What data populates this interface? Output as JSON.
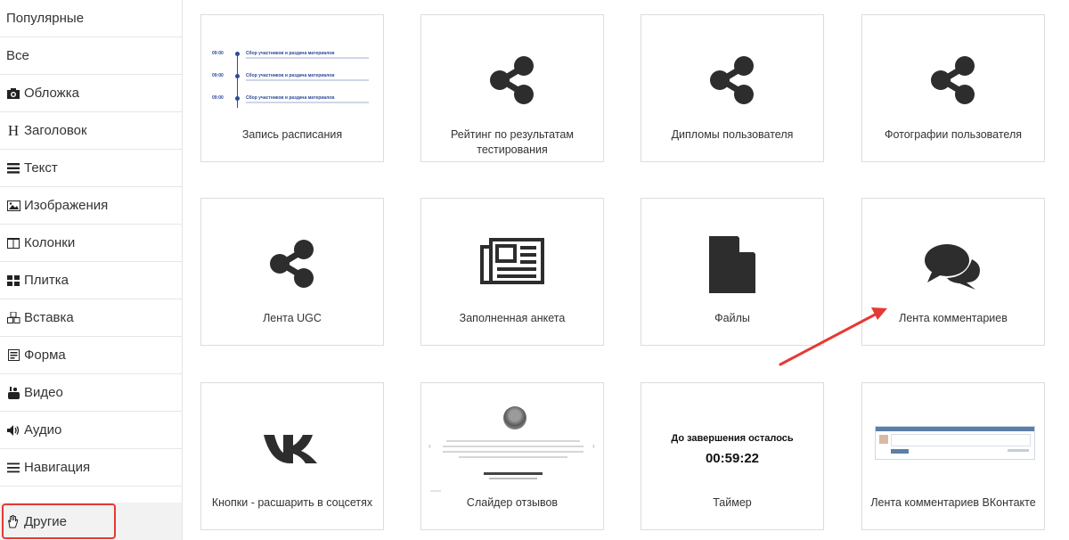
{
  "sidebar": {
    "items": [
      {
        "label": "Популярные",
        "icon": ""
      },
      {
        "label": "Все",
        "icon": ""
      },
      {
        "label": "Обложка",
        "icon": "camera-icon"
      },
      {
        "label": "Заголовок",
        "icon": "heading-icon"
      },
      {
        "label": "Текст",
        "icon": "text-lines-icon"
      },
      {
        "label": "Изображения",
        "icon": "image-icon"
      },
      {
        "label": "Колонки",
        "icon": "columns-icon"
      },
      {
        "label": "Плитка",
        "icon": "tiles-icon"
      },
      {
        "label": "Вставка",
        "icon": "cubes-icon"
      },
      {
        "label": "Форма",
        "icon": "form-icon"
      },
      {
        "label": "Видео",
        "icon": "youtube-icon"
      },
      {
        "label": "Аудио",
        "icon": "volume-icon"
      },
      {
        "label": "Навигация",
        "icon": "menu-icon"
      },
      {
        "label": "Другие",
        "icon": "hand-icon"
      }
    ],
    "active_index": 13,
    "heading_glyph": "H"
  },
  "cards": [
    {
      "label": "Запись расписания",
      "type": "schedule"
    },
    {
      "label": "Рейтинг по результатам тестирования",
      "type": "share"
    },
    {
      "label": "Дипломы пользователя",
      "type": "share"
    },
    {
      "label": "Фотографии пользователя",
      "type": "share"
    },
    {
      "label": "Лента UGC",
      "type": "share"
    },
    {
      "label": "Заполненная анкета",
      "type": "newspaper"
    },
    {
      "label": "Файлы",
      "type": "file"
    },
    {
      "label": "Лента комментариев",
      "type": "comments"
    },
    {
      "label": "Кнопки - расшарить в соцсетях",
      "type": "vk"
    },
    {
      "label": "Слайдер отзывов",
      "type": "slider"
    },
    {
      "label": "Таймер",
      "type": "timer"
    },
    {
      "label": "Лента комментариев ВКонтакте",
      "type": "vk-comments"
    }
  ],
  "schedule_preview": {
    "rows": [
      {
        "time": "09:00",
        "title": "Сбор участников и раздача материалов"
      },
      {
        "time": "09:00",
        "title": "Сбор участников и раздача материалов"
      },
      {
        "time": "09:00",
        "title": "Сбор участников и раздача материалов"
      }
    ]
  },
  "timer_preview": {
    "title": "До завершения осталось",
    "value": "00:59:22"
  },
  "colors": {
    "highlight": "#e53935",
    "arrow": "#e53935",
    "icon": "#2d2d2d"
  }
}
